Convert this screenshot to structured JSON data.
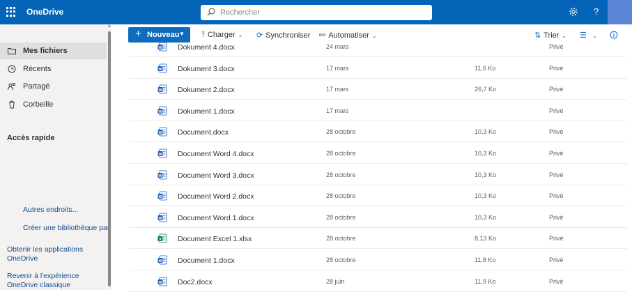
{
  "app": {
    "title": "OneDrive",
    "accent": "#0364b8",
    "icons": [
      "waffle-icon",
      "settings-icon",
      "help-icon"
    ]
  },
  "search": {
    "placeholder": "Rechercher"
  },
  "help_label": "?",
  "sidebar": {
    "items": [
      {
        "label": "Mes fichiers",
        "icon": "folder-icon",
        "active": true
      },
      {
        "label": "Récents",
        "icon": "clock-icon"
      },
      {
        "label": "Partagé",
        "icon": "shared-icon"
      },
      {
        "label": "Corbeille",
        "icon": "trash-icon"
      }
    ],
    "quick_access": "Accès rapide",
    "links": {
      "other_places": "Autres endroits...",
      "create_library": "Créer une bibliothèque partagée",
      "get_apps": "Obtenir les applications OneDrive",
      "classic": "Revenir à l'expérience OneDrive classique"
    }
  },
  "toolbar": {
    "new_label": "Nouveau",
    "upload_label": "Charger",
    "sync_label": "Synchroniser",
    "automate_label": "Automatiser",
    "sort_label": "Trier"
  },
  "files": [
    {
      "name": "Dokument 4.docx",
      "date": "24 mars",
      "size": "",
      "sharing": "Privé",
      "type": "word"
    },
    {
      "name": "Dokument 3.docx",
      "date": "17 mars",
      "size": "11,6 Ko",
      "sharing": "Privé",
      "type": "word"
    },
    {
      "name": "Dokument 2.docx",
      "date": "17 mars",
      "size": "26,7 Ko",
      "sharing": "Privé",
      "type": "word"
    },
    {
      "name": "Dokument 1.docx",
      "date": "17 mars",
      "size": "",
      "sharing": "Privé",
      "type": "word"
    },
    {
      "name": "Document.docx",
      "date": "28 octobre",
      "size": "10,3 Ko",
      "sharing": "Privé",
      "type": "word"
    },
    {
      "name": "Document Word 4.docx",
      "date": "28 octobre",
      "size": "10,3 Ko",
      "sharing": "Privé",
      "type": "word"
    },
    {
      "name": "Document Word 3.docx",
      "date": "28 octobre",
      "size": "10,3 Ko",
      "sharing": "Privé",
      "type": "word"
    },
    {
      "name": "Document Word 2.docx",
      "date": "28 octobre",
      "size": "10,3 Ko",
      "sharing": "Privé",
      "type": "word"
    },
    {
      "name": "Document Word 1.docx",
      "date": "28 octobre",
      "size": "10,3 Ko",
      "sharing": "Privé",
      "type": "word"
    },
    {
      "name": "Document Excel 1.xlsx",
      "date": "28 octobre",
      "size": "8,13 Ko",
      "sharing": "Privé",
      "type": "excel"
    },
    {
      "name": "Document 1.docx",
      "date": "28 octobre",
      "size": "11,8 Ko",
      "sharing": "Privé",
      "type": "word"
    },
    {
      "name": "Doc2.docx",
      "date": "28 juin",
      "size": "11,9 Ko",
      "sharing": "Privé",
      "type": "word"
    }
  ]
}
